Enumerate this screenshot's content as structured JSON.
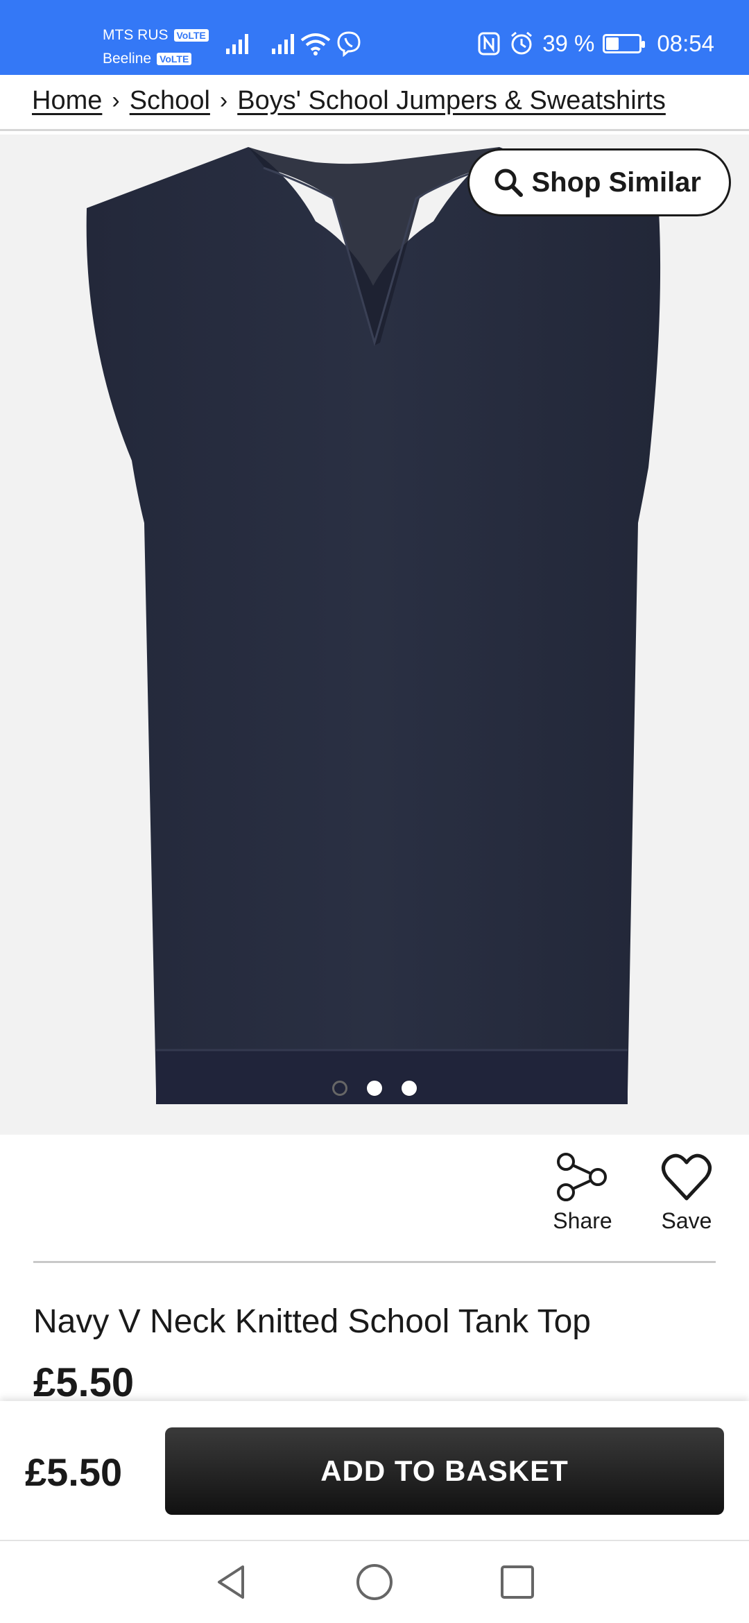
{
  "status_bar": {
    "carrier1": "MTS RUS",
    "carrier2": "Beeline",
    "volte_label": "VoLTE",
    "battery_percent": "39 %",
    "battery_level": 0.39,
    "time": "08:54"
  },
  "breadcrumb": {
    "items": [
      "Home",
      "School",
      "Boys' School Jumpers & Sweatshirts"
    ]
  },
  "image": {
    "shop_similar_label": "Shop Similar",
    "carousel_count": 3,
    "carousel_active_index": 0
  },
  "actions": {
    "share_label": "Share",
    "save_label": "Save"
  },
  "product": {
    "title": "Navy V Neck Knitted School Tank Top",
    "price": "£5.50"
  },
  "sticky_bar": {
    "price": "£5.50",
    "add_to_basket_label": "ADD TO BASKET"
  },
  "colors": {
    "status_bar": "#3478f6",
    "garment": "#262b3d",
    "button": "#1a1a1a"
  }
}
